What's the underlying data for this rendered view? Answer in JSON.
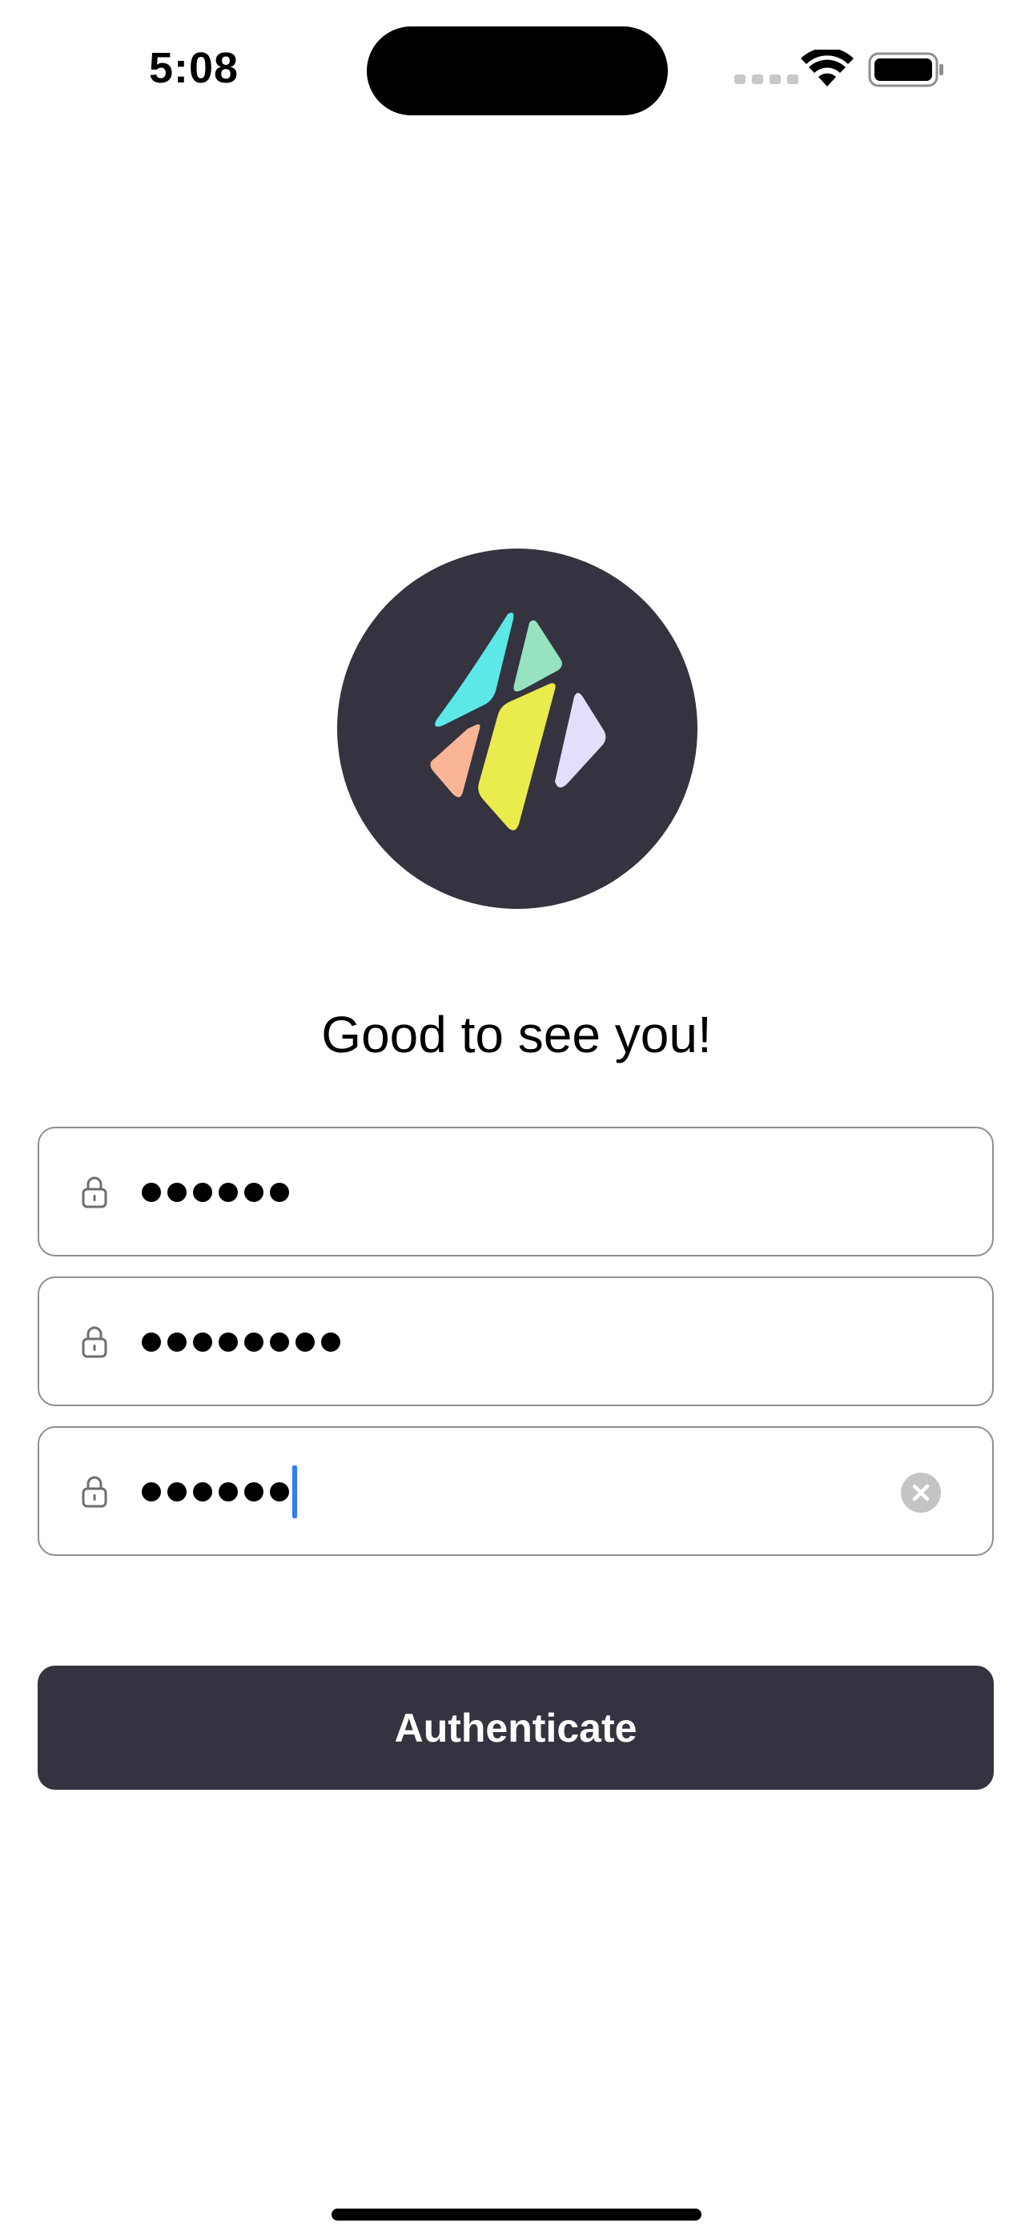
{
  "status_bar": {
    "time": "5:08"
  },
  "logo": {
    "icon": "app-logo-icon",
    "background": "#34333f",
    "petal_colors": [
      "#5ce8e6",
      "#96e2c1",
      "#fab596",
      "#eaeb4d",
      "#e4defa"
    ]
  },
  "greeting": "Good to see you!",
  "fields": [
    {
      "masked_length": 6,
      "icon": "lock-icon",
      "focused": false
    },
    {
      "masked_length": 8,
      "icon": "lock-icon",
      "focused": false
    },
    {
      "masked_length": 6,
      "icon": "lock-icon",
      "focused": true,
      "clear_icon": "clear-icon"
    }
  ],
  "authenticate_label": "Authenticate",
  "colors": {
    "accent": "#34333f",
    "caret": "#2e7cf6",
    "field_border": "#8e8e93"
  }
}
